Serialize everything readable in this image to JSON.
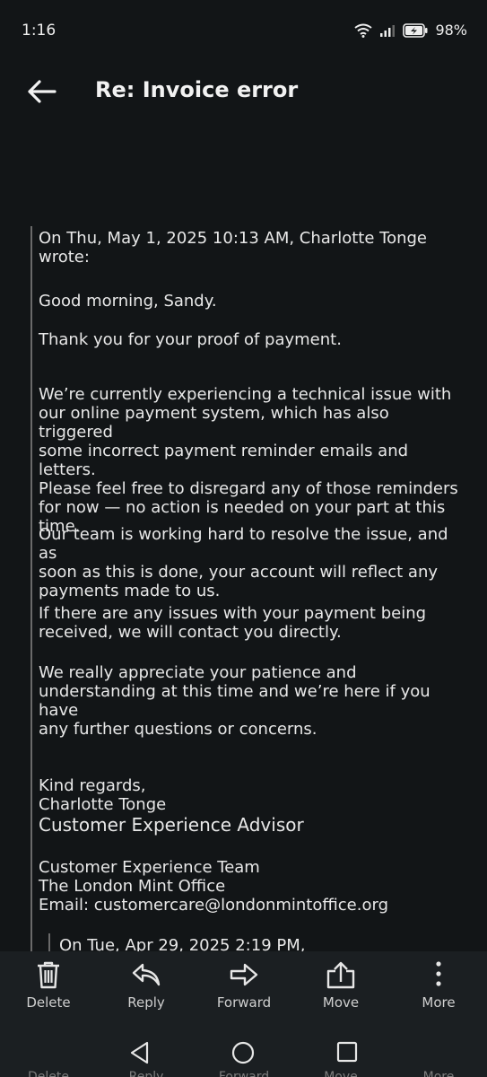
{
  "status_bar": {
    "time": "1:16",
    "battery": "98%"
  },
  "header": {
    "subject": "Re: Invoice error"
  },
  "message": {
    "attribution": "On Thu, May 1, 2025 10:13 AM, Charlotte Tonge\nwrote:",
    "greeting": "Good morning, Sandy.",
    "p1": "Thank you for your proof of payment.",
    "p2": "We’re currently experiencing a technical issue with\nour online payment system, which has also triggered\nsome incorrect payment reminder emails and letters.\nPlease feel free to disregard any of those reminders\nfor now — no action is needed on your part at this\ntime.",
    "p3": "Our team is working hard to resolve the issue, and as\nsoon as this is done, your account will reflect any\npayments made to us.",
    "p4": "If there are any issues with your payment being\nreceived, we will contact you directly.",
    "p5": "We really appreciate your patience and\nunderstanding at this time and we’re here if you have\nany further questions or concerns.",
    "sign_off": "Kind regards,\nCharlotte Tonge",
    "job_title": "Customer Experience Advisor",
    "team": "Customer Experience Team\nThe London Mint Office\nEmail: customercare@londonmintoffice.org",
    "nested_quote": "On Tue, Apr 29, 2025 2:19 PM,"
  },
  "toolbar": {
    "delete": "Delete",
    "reply": "Reply",
    "forward": "Forward",
    "move": "Move",
    "more": "More"
  }
}
